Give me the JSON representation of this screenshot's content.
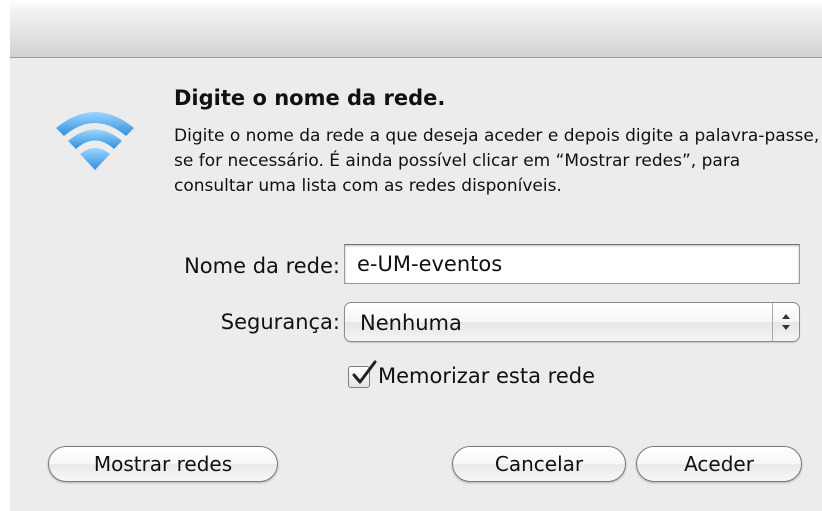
{
  "dialog": {
    "heading": "Digite o nome da rede.",
    "description": "Digite o nome da rede a que deseja aceder e depois digite a palavra-passe, se for necessário. É ainda possível clicar em “Mostrar redes”, para consultar uma lista com as redes disponíveis.",
    "icon": "wifi-icon",
    "accent_color": "#3b9ae0"
  },
  "form": {
    "network_name_label": "Nome da rede:",
    "network_name_value": "e-UM-eventos",
    "security_label": "Segurança:",
    "security_value": "Nenhuma",
    "remember_label": "Memorizar esta rede",
    "remember_checked": true
  },
  "buttons": {
    "show_networks": "Mostrar redes",
    "cancel": "Cancelar",
    "join": "Aceder"
  }
}
